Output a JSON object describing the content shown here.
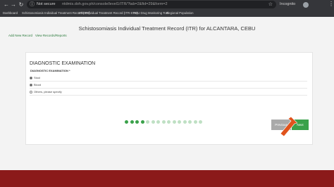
{
  "browser": {
    "security_label": "Not secure",
    "url": "ntdmis.doh.gov.ph/console/level1/ITR/?tab=2&fid=29&form=2",
    "incognito_label": "Incognito"
  },
  "bookmarks": [
    "Dashboard",
    "Schistosomiasis Individual Treatment Record (ITR)",
    "STH Individual Treatment Record (ITR-STH)",
    "RHU Drug Monitoring Tool",
    "Regional Population"
  ],
  "page": {
    "title": "Schistosomiasis Individual Treatment Record (ITR) for ALCANTARA, CEBU",
    "links": {
      "add_new": "Add New Record",
      "view_records": "View Records/Reports"
    }
  },
  "form": {
    "section_title": "DIAGNOSTIC EXAMINATION",
    "field_label": "DIAGNOSTIC EXAMINATION *",
    "options": [
      {
        "label": "Stool",
        "checked": true
      },
      {
        "label": "Blood",
        "checked": true
      },
      {
        "label": "Others, please specify",
        "checked": false
      }
    ],
    "previous_label": "Previous",
    "next_label": "Next"
  },
  "progress": {
    "total_steps": 15,
    "current_step": 4
  },
  "colors": {
    "accent": "#3aa14a",
    "footer": "#8b1a1a",
    "arrow": "#e0531c"
  }
}
